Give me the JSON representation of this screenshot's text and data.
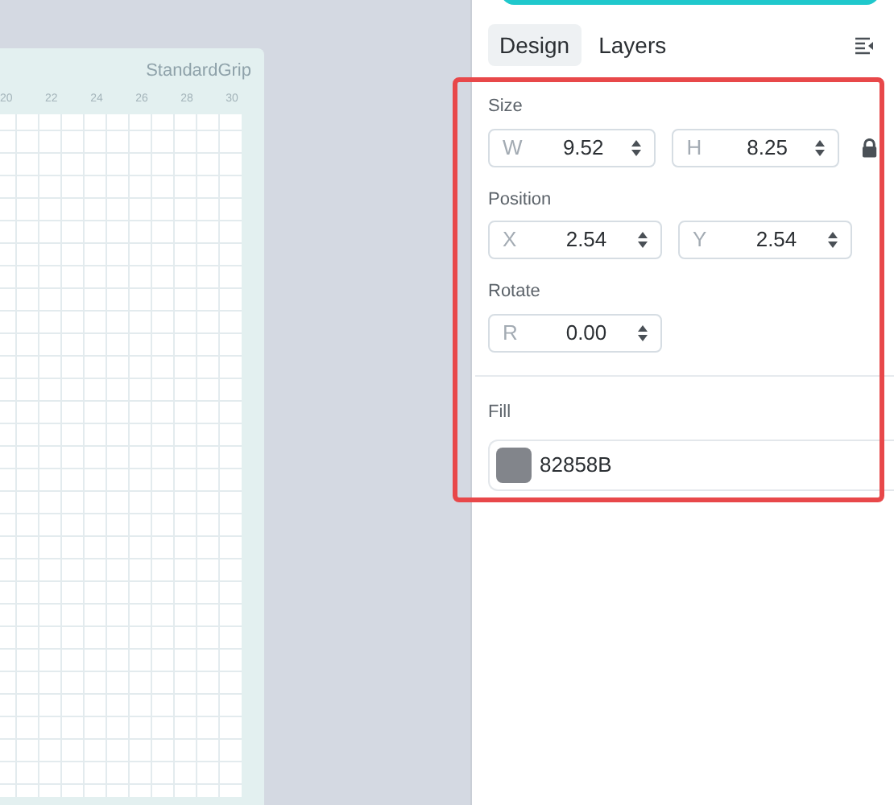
{
  "mat": {
    "label": "StandardGrip",
    "ruler_ticks": [
      "20",
      "22",
      "24",
      "26",
      "28",
      "30"
    ]
  },
  "tabs": [
    {
      "label": "Design",
      "selected": true
    },
    {
      "label": "Layers",
      "selected": false
    }
  ],
  "size": {
    "label": "Size",
    "fields": [
      {
        "axis": "W",
        "value": "9.52"
      },
      {
        "axis": "H",
        "value": "8.25"
      }
    ],
    "locked": true
  },
  "position": {
    "label": "Position",
    "fields": [
      {
        "axis": "X",
        "value": "2.54"
      },
      {
        "axis": "Y",
        "value": "2.54"
      }
    ]
  },
  "rotate": {
    "label": "Rotate",
    "fields": [
      {
        "axis": "R",
        "value": "0.00"
      }
    ]
  },
  "fill": {
    "label": "Fill",
    "color": "#82858b",
    "value": "82858B"
  }
}
